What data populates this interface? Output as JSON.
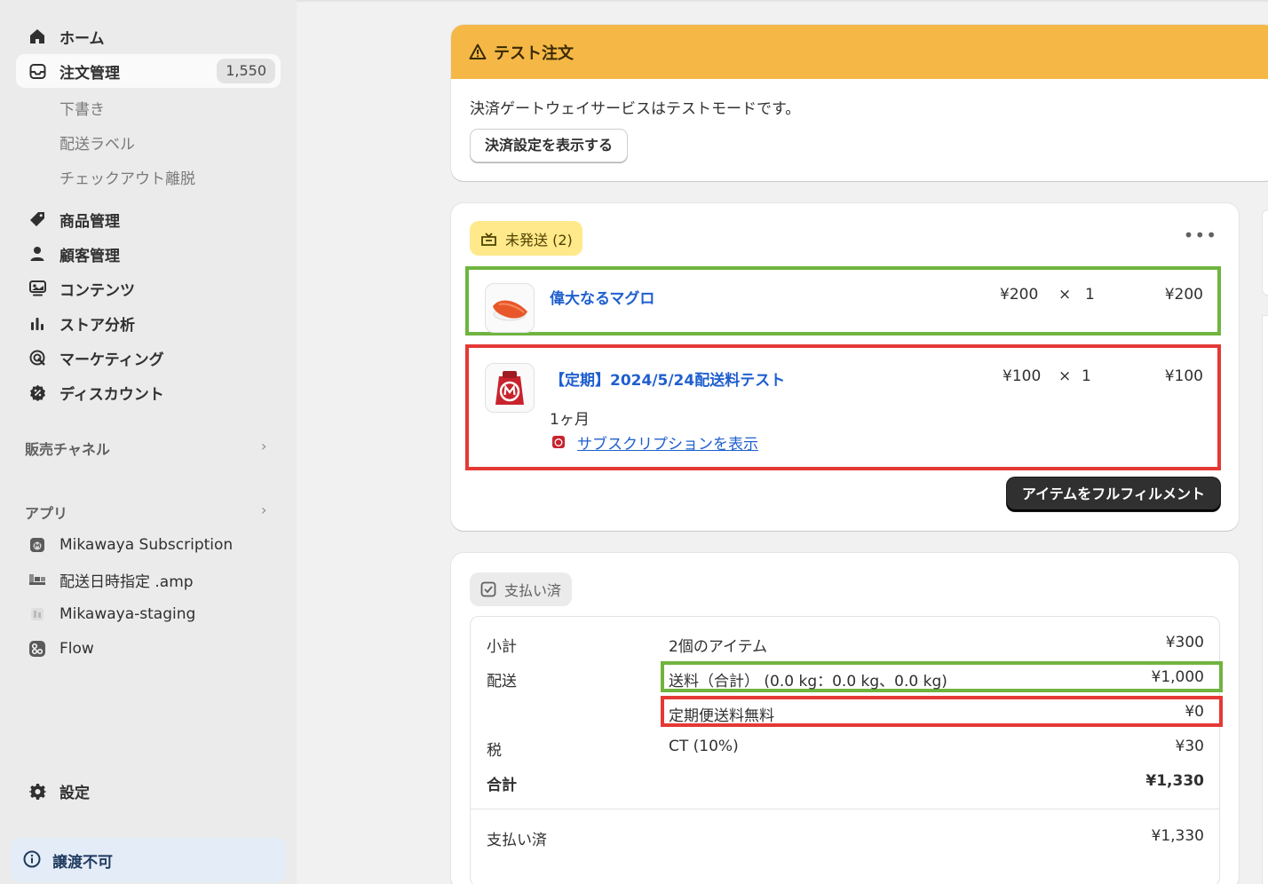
{
  "sidebar": {
    "nav": [
      {
        "label": "ホーム",
        "icon": "home-icon"
      },
      {
        "label": "注文管理",
        "icon": "inbox-icon",
        "badge": "1,550",
        "active": true
      },
      {
        "label": "商品管理",
        "icon": "tag-icon"
      },
      {
        "label": "顧客管理",
        "icon": "person-icon"
      },
      {
        "label": "コンテンツ",
        "icon": "content-icon"
      },
      {
        "label": "ストア分析",
        "icon": "bar-chart-icon"
      },
      {
        "label": "マーケティング",
        "icon": "target-icon"
      },
      {
        "label": "ディスカウント",
        "icon": "discount-icon"
      }
    ],
    "order_sub": [
      "下書き",
      "配送ラベル",
      "チェックアウト離脱"
    ],
    "sales_channels_label": "販売チャネル",
    "apps_label": "アプリ",
    "apps": [
      {
        "label": "Mikawaya Subscription",
        "icon": "subscription-app-icon"
      },
      {
        "label": "配送日時指定 .amp",
        "icon": "delivery-app-icon"
      },
      {
        "label": "Mikawaya-staging",
        "icon": "staging-app-icon"
      },
      {
        "label": "Flow",
        "icon": "flow-app-icon"
      }
    ],
    "settings_label": "設定",
    "non_transferable_label": "譲渡不可"
  },
  "banner": {
    "title": "テスト注文",
    "text": "決済ゲートウェイサービスはテストモードです。",
    "button": "決済設定を表示する",
    "color": "#f5b846"
  },
  "fulfillment": {
    "status": "未発送 (2)",
    "items": [
      {
        "title": "偉大なるマグロ",
        "unit_price": "¥200",
        "times": "×",
        "qty": "1",
        "total": "¥200"
      },
      {
        "title": "【定期】2024/5/24配送料テスト",
        "unit_price": "¥100",
        "times": "×",
        "qty": "1",
        "total": "¥100",
        "plan": "1ヶ月",
        "link": "サブスクリプションを表示"
      }
    ],
    "fulfill_button": "アイテムをフルフィルメント"
  },
  "payment": {
    "status": "支払い済",
    "rows": {
      "subtotal": {
        "label": "小計",
        "desc": "2個のアイテム",
        "amount": "¥300"
      },
      "shipping": {
        "label": "配送",
        "desc": "送料（合計） (0.0 kg：0.0 kg、0.0 kg)",
        "amount": "¥1,000"
      },
      "shipping_free": {
        "desc": "定期便送料無料",
        "amount": "¥0"
      },
      "tax": {
        "label": "税",
        "desc": "CT (10%)",
        "amount": "¥30"
      },
      "total": {
        "label": "合計",
        "amount": "¥1,330"
      },
      "paid": {
        "label": "支払い済",
        "amount": "¥1,330"
      }
    }
  },
  "annotation_colors": {
    "green": "#6fb43f",
    "red": "#e53935"
  }
}
